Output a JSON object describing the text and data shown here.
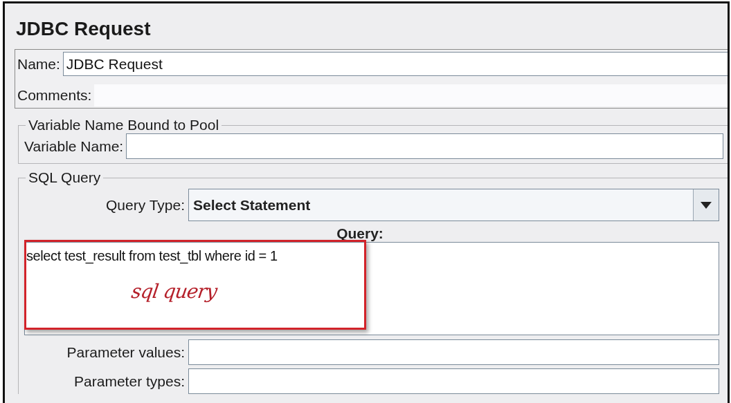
{
  "window": {
    "title": "JDBC Request"
  },
  "name_field": {
    "label": "Name:",
    "value": "JDBC Request"
  },
  "comments_field": {
    "label": "Comments:"
  },
  "variable_group": {
    "title": "Variable Name Bound to Pool",
    "label": "Variable Name:"
  },
  "sql_group": {
    "title": "SQL Query",
    "query_type": {
      "label": "Query Type:",
      "value": "Select Statement"
    },
    "query": {
      "label": "Query:",
      "value": "select test_result from test_tbl where id = 1"
    },
    "parameters": [
      {
        "label": "Parameter values:"
      },
      {
        "label": "Parameter types:"
      }
    ]
  },
  "annotation": {
    "text": "sql query"
  }
}
